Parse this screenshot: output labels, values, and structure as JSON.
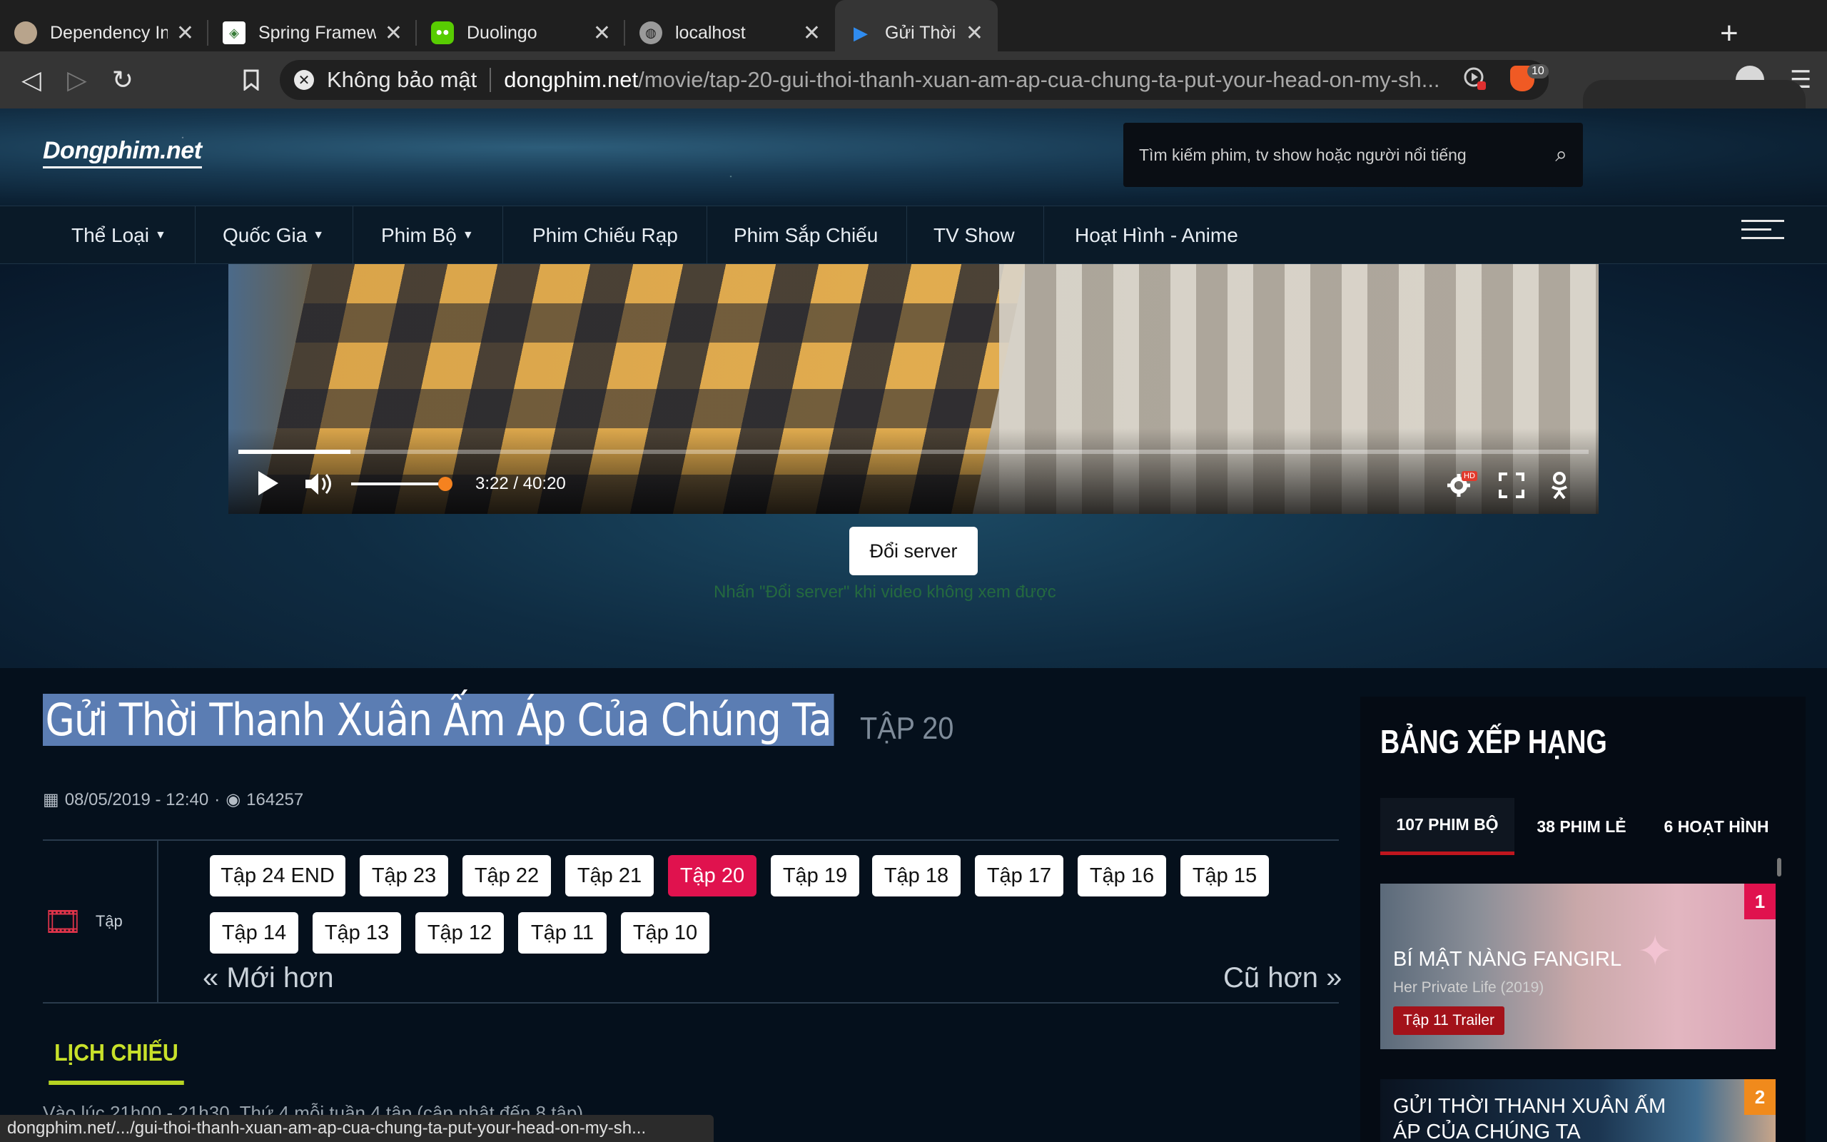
{
  "browser": {
    "tabs": [
      {
        "title": "Dependency Injection và Inversio",
        "icon": "avatar-icon"
      },
      {
        "title": "Spring Framework Overview",
        "icon": "spring-icon"
      },
      {
        "title": "Duolingo",
        "icon": "duolingo-icon"
      },
      {
        "title": "localhost",
        "icon": "globe-icon"
      },
      {
        "title": "Gửi Thời Thanh Xuân Ấm Áp Của",
        "icon": "play-icon"
      }
    ],
    "security_label": "Không bảo mật",
    "url_host": "dongphim.net",
    "url_path": "/movie/tap-20-gui-thoi-thanh-xuan-am-ap-cua-chung-ta-put-your-head-on-my-sh...",
    "brave_badge": "10",
    "status_url": "dongphim.net/.../gui-thoi-thanh-xuan-am-ap-cua-chung-ta-put-your-head-on-my-sh..."
  },
  "site": {
    "logo": "Dongphim.net",
    "search_placeholder": "Tìm kiếm phim, tv show hoặc người nổi tiếng",
    "nav": [
      {
        "label": "Thể Loại",
        "dropdown": true
      },
      {
        "label": "Quốc Gia",
        "dropdown": true
      },
      {
        "label": "Phim Bộ",
        "dropdown": true
      },
      {
        "label": "Phim Chiếu Rạp",
        "dropdown": false
      },
      {
        "label": "Phim Sắp Chiếu",
        "dropdown": false
      },
      {
        "label": "TV Show",
        "dropdown": false
      },
      {
        "label": "Hoạt Hình - Anime",
        "dropdown": false
      }
    ]
  },
  "player": {
    "time": "3:22 / 40:20",
    "progress_fraction": 0.083,
    "volume_fraction": 0.62,
    "quality_badge": "HD",
    "server_button": "Đổi server",
    "server_note": "Nhấn \"Đổi server\" khi video không xem được"
  },
  "movie": {
    "title": "Gửi Thời Thanh Xuân Ấm Áp Của Chúng Ta",
    "episode": "TẬP 20",
    "date": "08/05/2019 - 12:40",
    "views": "164257",
    "episodes_label": "Tập",
    "episodes": [
      "Tập 24 END",
      "Tập 23",
      "Tập 22",
      "Tập 21",
      "Tập 20",
      "Tập 19",
      "Tập 18",
      "Tập 17",
      "Tập 16",
      "Tập 15",
      "Tập 14",
      "Tập 13",
      "Tập 12",
      "Tập 11",
      "Tập 10"
    ],
    "current_episode": "Tập 20",
    "newer": "« Mới hơn",
    "older": "Cũ hơn »",
    "schedule_tab": "LỊCH CHIẾU",
    "schedule_text": "Vào lúc 21h00 - 21h30, Thứ 4 mỗi tuần 4 tập (cập nhật đến 8 tập)"
  },
  "ranking": {
    "title": "BẢNG XẾP HẠNG",
    "tabs": [
      "107 PHIM BỘ",
      "38 PHIM LẺ",
      "6 HOẠT HÌNH"
    ],
    "items": [
      {
        "rank": "1",
        "name": "BÍ MẬT NÀNG FANGIRL",
        "original": "Her Private Life (2019)",
        "badge": "Tập 11 Trailer",
        "rank_color": "#e0124e"
      },
      {
        "rank": "2",
        "name": "GỬI THỜI THANH XUÂN ẤM ÁP CỦA CHÚNG TA",
        "original": "",
        "badge": "",
        "rank_color": "#f08a1c"
      }
    ]
  },
  "colors": {
    "accent_red": "#e0124e",
    "schedule_green": "#c8e12a",
    "player_orange": "#f5821f"
  }
}
